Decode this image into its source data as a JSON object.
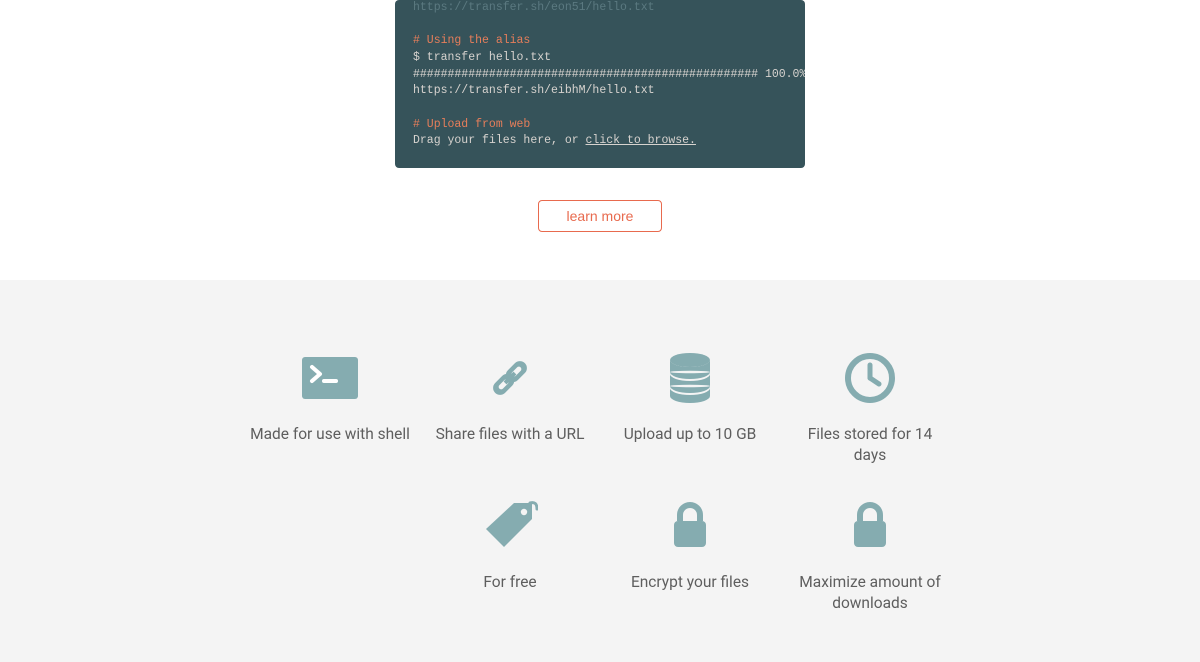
{
  "terminal": {
    "faded_prefix": "https://transfer.sh/eon51/hello.txt",
    "block1_comment": "# Using the alias",
    "block1_cmd": "$ transfer hello.txt",
    "block1_progress": "################################################## 100.0%",
    "block1_url": "https://transfer.sh/eibhM/hello.txt",
    "block2_comment": "# Upload from web",
    "block2_text_pre": "Drag your files here, or ",
    "block2_link": "click to browse."
  },
  "learn_more": "learn more",
  "features": [
    {
      "label": "Made for use with shell"
    },
    {
      "label": "Share files with a URL"
    },
    {
      "label": "Upload up to 10 GB"
    },
    {
      "label": "Files stored for 14 days"
    },
    {
      "label": "For free"
    },
    {
      "label": "Encrypt your files"
    },
    {
      "label": "Maximize amount of downloads"
    }
  ],
  "colors": {
    "teal": "#85acb0",
    "accent": "#e86a4e",
    "terminal_bg": "#36535a",
    "section_bg": "#f4f4f4"
  }
}
